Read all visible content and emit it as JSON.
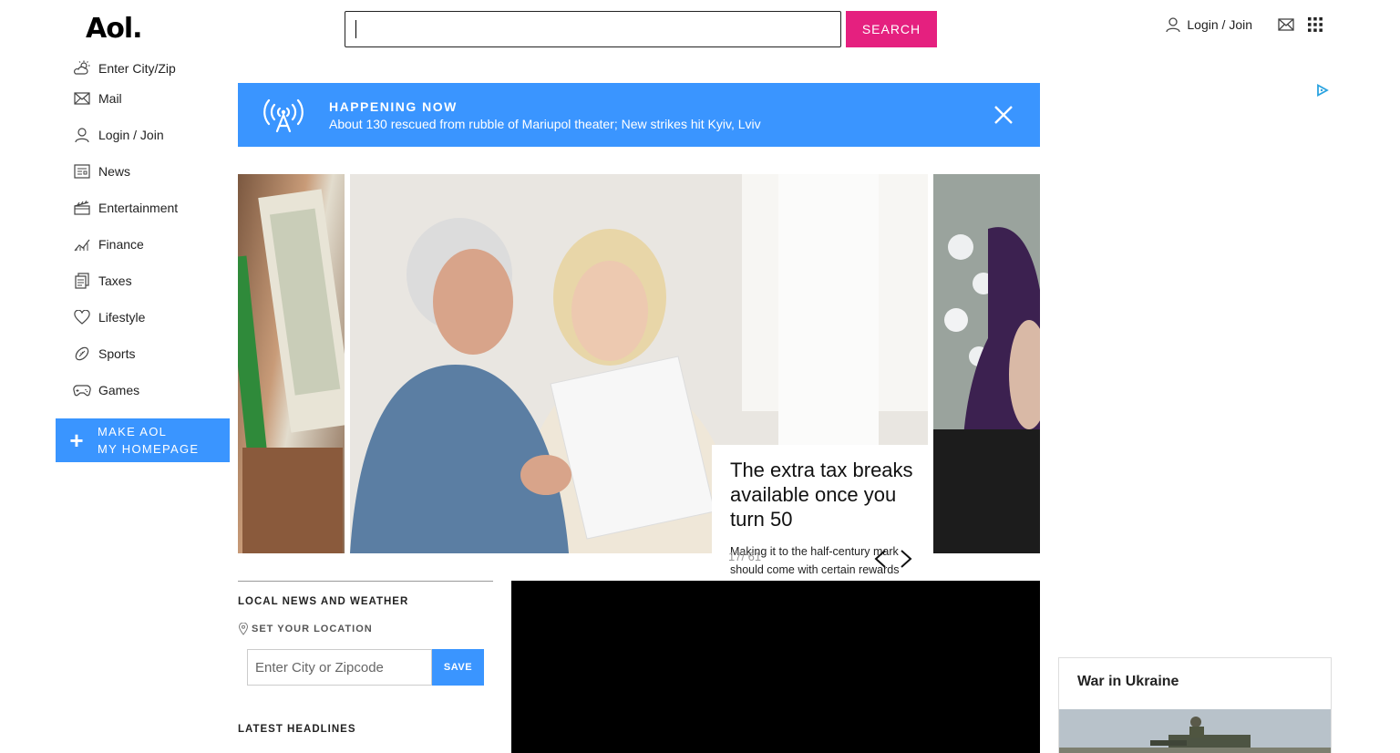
{
  "header": {
    "logo": "Aol.",
    "search_placeholder": "",
    "search_button": "SEARCH",
    "login_label": "Login / Join"
  },
  "sidebar": {
    "items": [
      {
        "label": "Enter City/Zip",
        "icon": "weather-icon"
      },
      {
        "label": "Mail",
        "icon": "mail-icon"
      },
      {
        "label": "Login / Join",
        "icon": "user-icon"
      },
      {
        "label": "News",
        "icon": "news-icon"
      },
      {
        "label": "Entertainment",
        "icon": "clapper-icon"
      },
      {
        "label": "Finance",
        "icon": "finance-icon"
      },
      {
        "label": "Taxes",
        "icon": "taxes-icon"
      },
      {
        "label": "Lifestyle",
        "icon": "heart-icon"
      },
      {
        "label": "Sports",
        "icon": "football-icon"
      },
      {
        "label": "Games",
        "icon": "gamepad-icon"
      }
    ],
    "homepage_line1": "MAKE AOL",
    "homepage_line2": "MY HOMEPAGE"
  },
  "banner": {
    "title": "HAPPENING NOW",
    "headline": "About 130 rescued from rubble of Mariupol theater; New strikes hit Kyiv, Lviv"
  },
  "carousel": {
    "title": "The extra tax breaks available once you turn 50",
    "description": "Making it to the half-century mark should come with certain rewards",
    "counter": "17/ 61"
  },
  "local": {
    "heading": "LOCAL NEWS AND WEATHER",
    "set_location": "SET YOUR LOCATION",
    "zip_placeholder": "Enter City or Zipcode",
    "save_button": "SAVE",
    "latest_headlines": "LATEST HEADLINES"
  },
  "right_rail": {
    "war_title": "War in Ukraine"
  },
  "colors": {
    "accent_blue": "#3a95ff",
    "search_pink": "#e5207f"
  }
}
